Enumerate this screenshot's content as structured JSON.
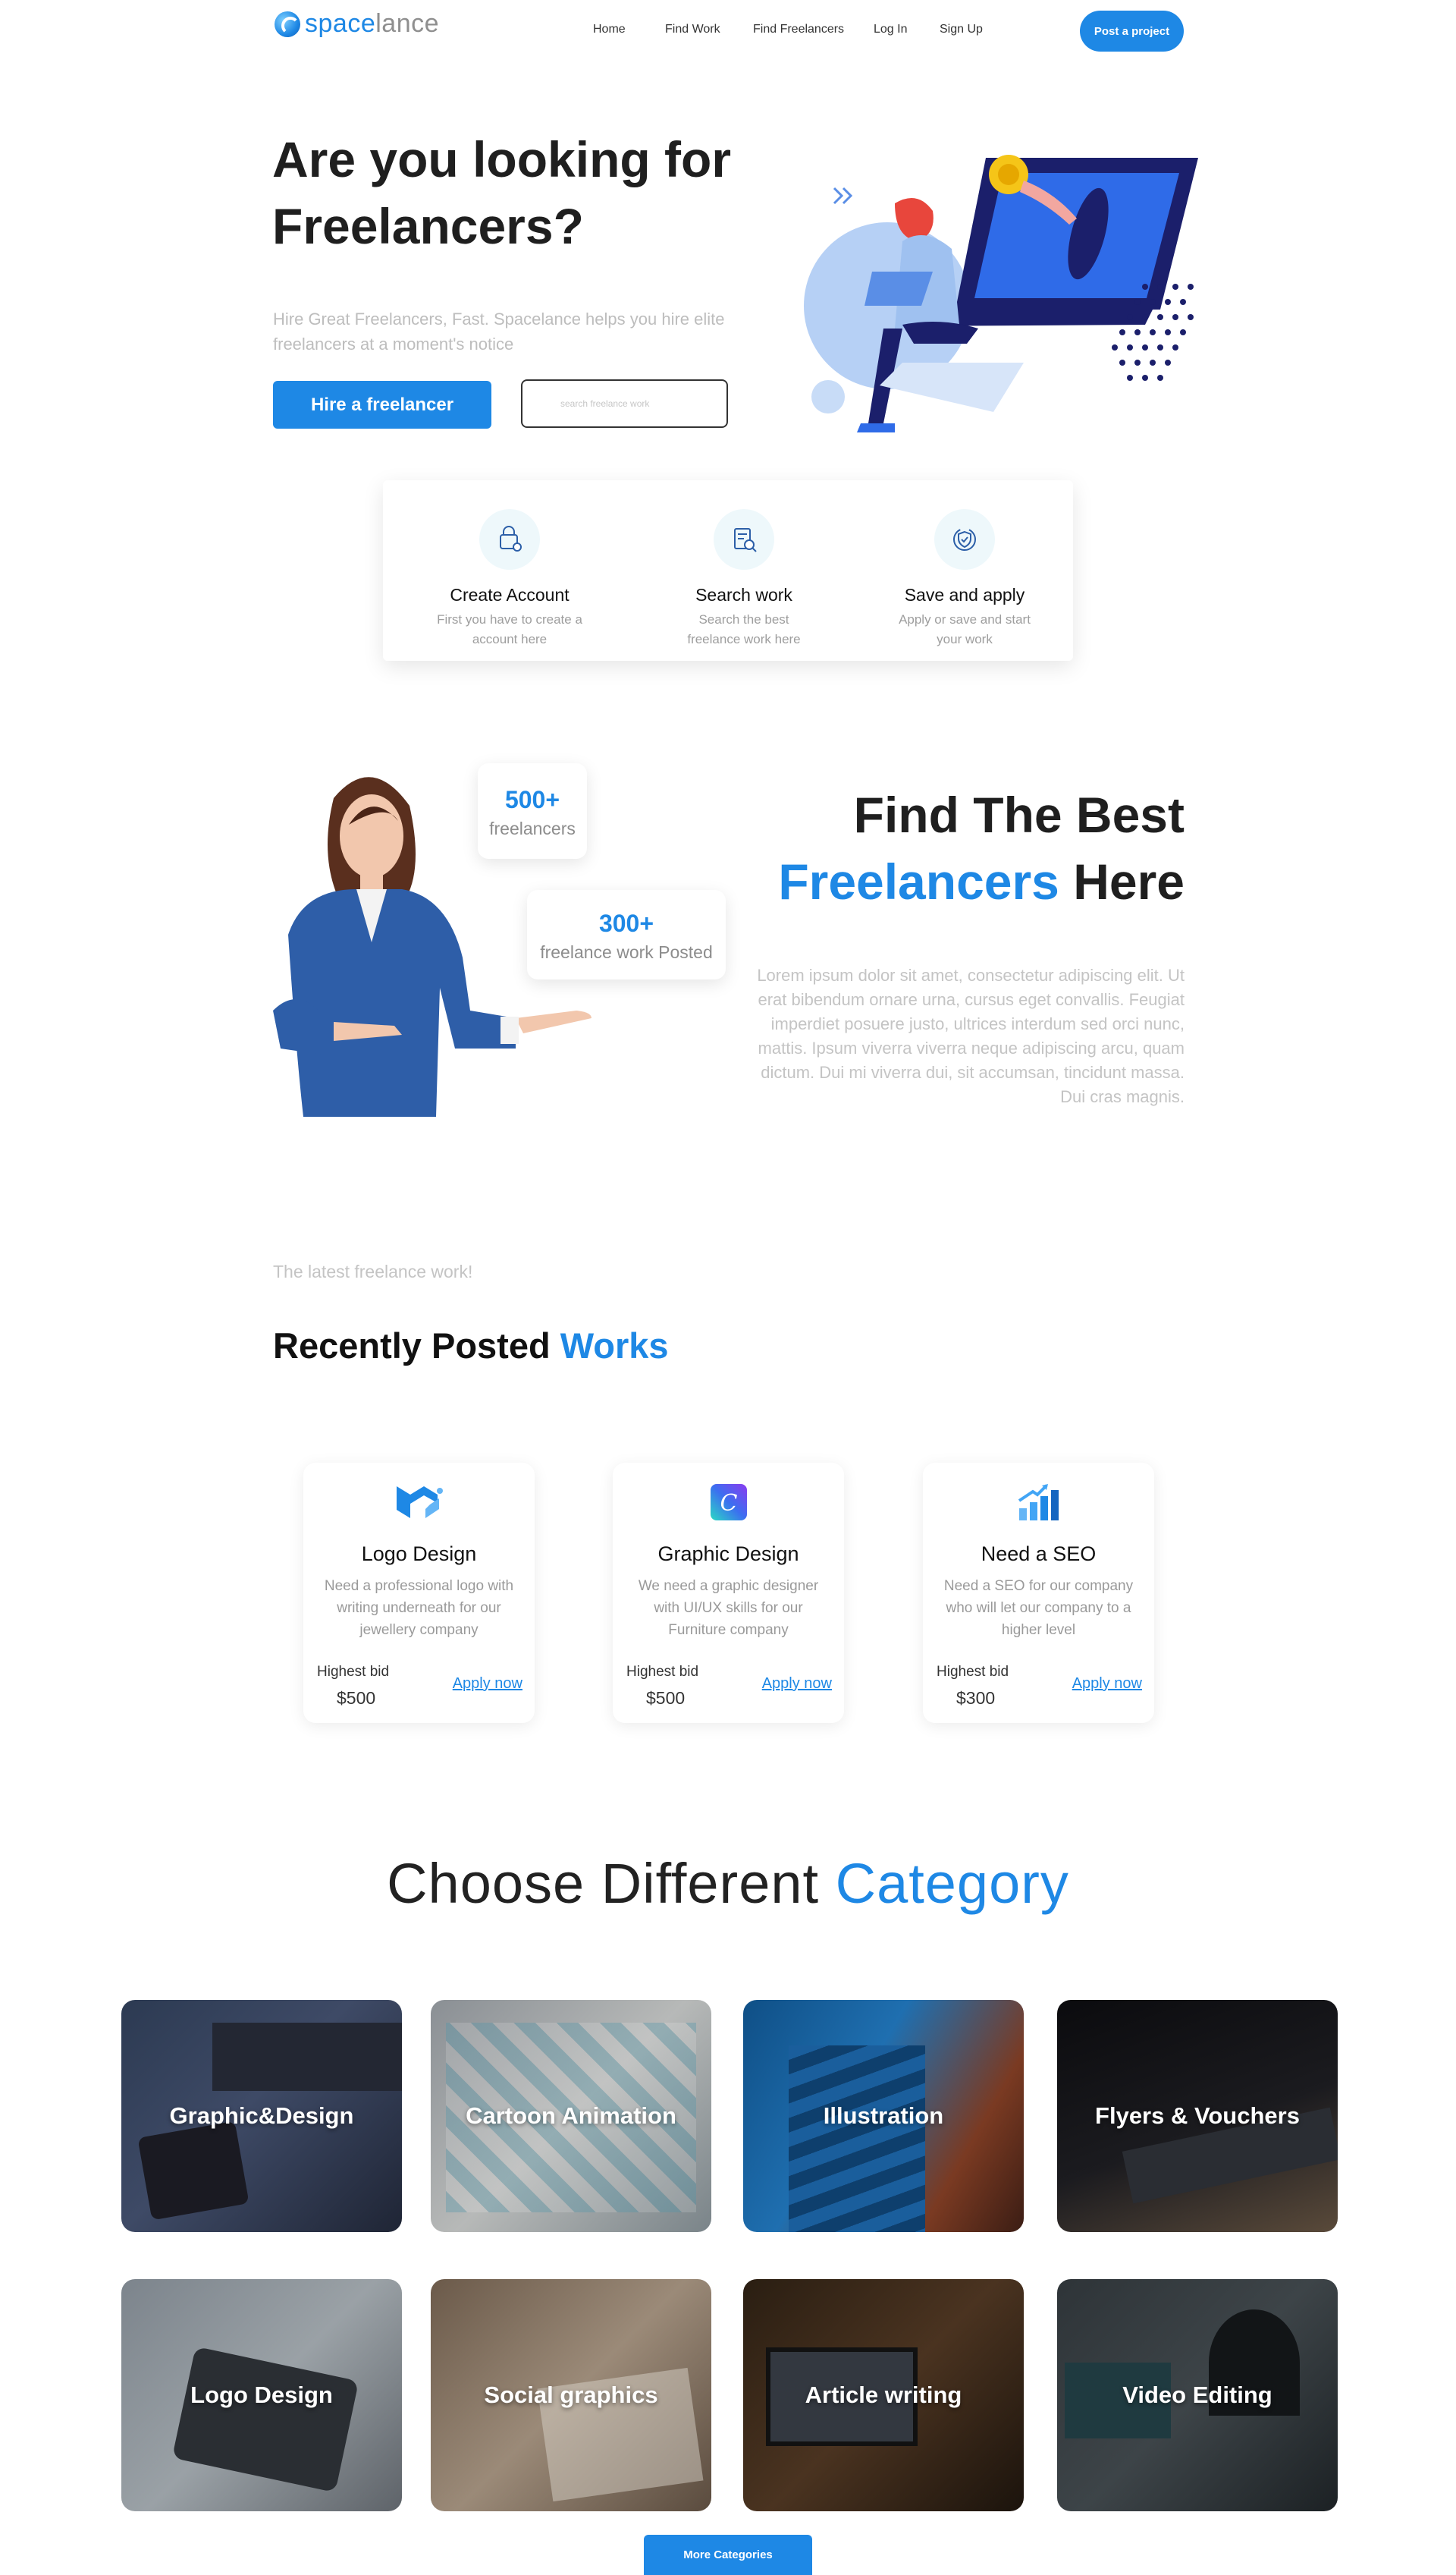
{
  "brand": {
    "name_a": "space",
    "name_b": "lance"
  },
  "nav": {
    "items": [
      "Home",
      "Find Work",
      "Find Freelancers",
      "Log In",
      "Sign Up"
    ],
    "cta": "Post a project"
  },
  "hero": {
    "title": "Are you looking for Freelancers?",
    "subtitle": "Hire Great Freelancers, Fast. Spacelance helps you hire elite freelancers at a moment's notice",
    "primary_button": "Hire a freelancer",
    "search_placeholder": "search freelance work"
  },
  "steps": [
    {
      "title": "Create Account",
      "desc": "First you have to create a account  here",
      "icon": "lock-file-icon"
    },
    {
      "title": "Search work",
      "desc": "Search the best freelance work here",
      "icon": "search-document-icon"
    },
    {
      "title": "Save and apply",
      "desc": "Apply or save and start your work",
      "icon": "shield-check-icon"
    }
  ],
  "find": {
    "title_line1": "Find The Best",
    "title_blue": "Freelancers",
    "title_rest": " Here",
    "paragraph": "Lorem ipsum dolor sit amet, consectetur adipiscing elit. Ut erat bibendum ornare urna, cursus eget convallis. Feugiat imperdiet posuere justo, ultrices interdum sed orci nunc, mattis. Ipsum viverra viverra neque adipiscing arcu, quam dictum. Dui mi viverra dui, sit accumsan, tincidunt massa. Dui cras magnis.",
    "stats": [
      {
        "num": "500+",
        "label": "freelancers"
      },
      {
        "num": "300+",
        "label": "freelance work Posted"
      }
    ]
  },
  "recent": {
    "kicker": "The latest freelance work!",
    "title": "Recently Posted ",
    "title_blue": "Works",
    "jobs": [
      {
        "title": "Logo Design",
        "desc": "Need a professional logo with writing underneath for our jewellery company",
        "bid_label": "Highest bid",
        "bid": "$500",
        "apply": "Apply now",
        "icon": "mui-logo-icon"
      },
      {
        "title": "Graphic Design",
        "desc": "We need a graphic designer with UI/UX skills for our Furniture company",
        "bid_label": "Highest bid",
        "bid": "$500",
        "apply": "Apply now",
        "icon": "canva-logo-icon"
      },
      {
        "title": "Need a SEO",
        "desc": "Need a SEO for our company who will let our company to a higher level",
        "bid_label": "Highest bid",
        "bid": "$300",
        "apply": "Apply now",
        "icon": "bar-growth-icon"
      }
    ]
  },
  "categories": {
    "title": "Choose Different ",
    "title_blue": "Category",
    "items": [
      "Graphic&Design",
      "Cartoon Animation",
      "Illustration",
      "Flyers & Vouchers",
      "Logo Design",
      "Social graphics",
      "Article writing",
      "Video Editing"
    ],
    "more": "More Categories"
  },
  "colors": {
    "accent": "#1e88e5",
    "text": "#1f1f1f",
    "muted": "#bdbdbd"
  }
}
